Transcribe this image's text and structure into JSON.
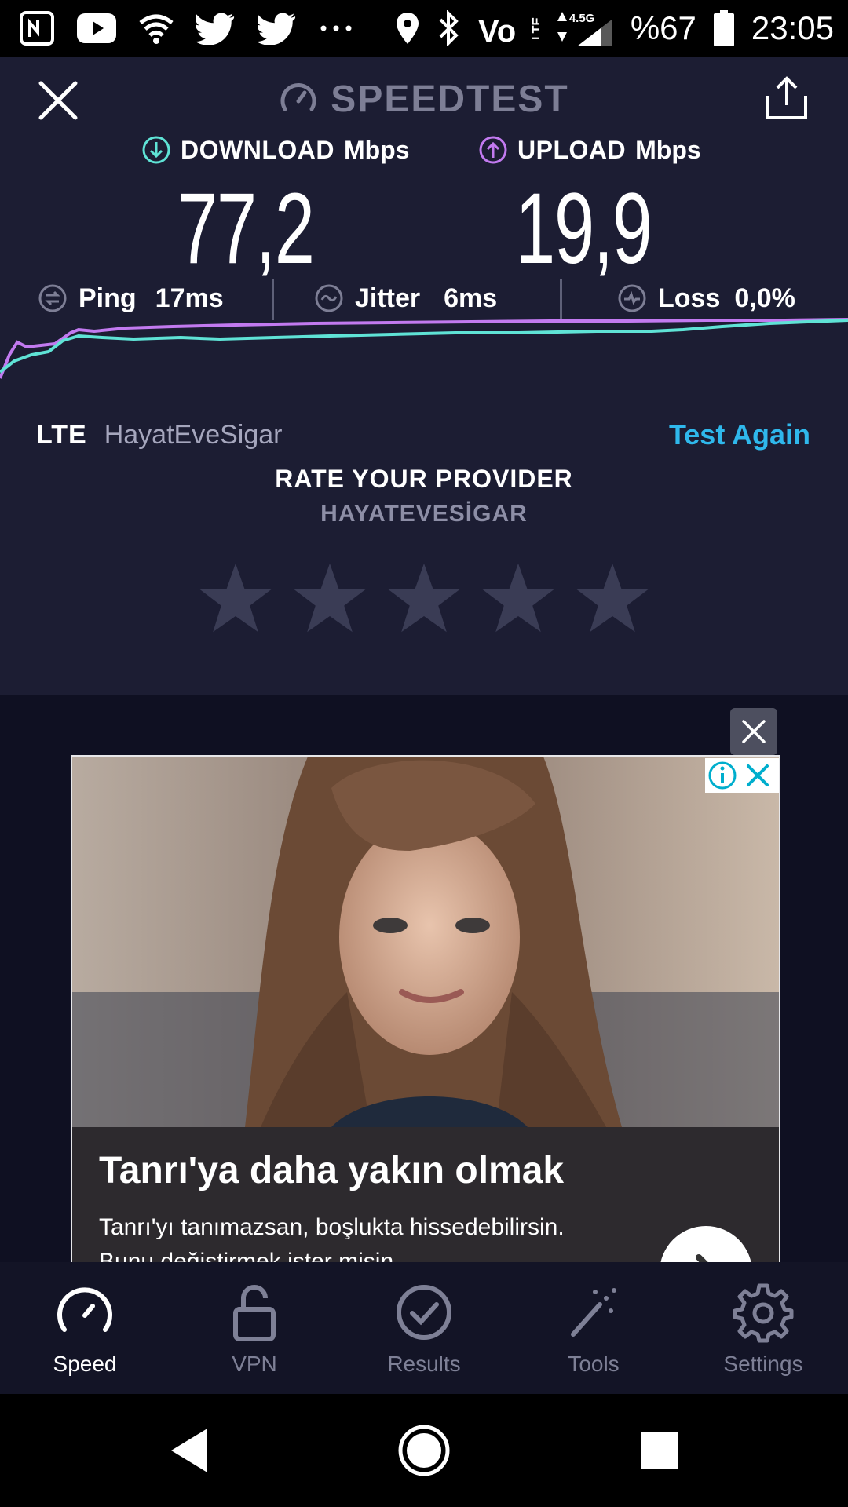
{
  "status_bar": {
    "icons": [
      "nfc-icon",
      "youtube-icon",
      "wifi-icon",
      "twitter-icon",
      "twitter-icon",
      "more-icon",
      "location-icon",
      "bluetooth-icon",
      "volte-icon",
      "signal-icon",
      "battery-icon"
    ],
    "network_type": "4.5G",
    "battery": "%67",
    "time": "23:05"
  },
  "header": {
    "title": "SPEEDTEST"
  },
  "download": {
    "label": "DOWNLOAD",
    "unit": "Mbps",
    "value": "77,2",
    "color": "#5fe3d6"
  },
  "upload": {
    "label": "UPLOAD",
    "unit": "Mbps",
    "value": "19,9",
    "color": "#c27af0"
  },
  "stats": {
    "ping": {
      "label": "Ping",
      "value": "17ms"
    },
    "jitter": {
      "label": "Jitter",
      "value": "6ms"
    },
    "loss": {
      "label": "Loss",
      "value": "0,0%"
    }
  },
  "network": {
    "type": "LTE",
    "provider": "HayatEveSigar",
    "test_again": "Test Again"
  },
  "rating": {
    "title": "RATE YOUR PROVIDER",
    "provider": "HAYATEVESİGAR",
    "stars": 5,
    "filled": 0
  },
  "ad": {
    "headline": "Tanrı'ya daha yakın olmak",
    "body_line1": "Tanrı'yı tanımazsan, boşlukta hissedebilirsin.",
    "body_line2": "Bunu değiştirmek ister misin..."
  },
  "bottom_nav": [
    {
      "label": "Speed",
      "icon": "speedometer-icon",
      "active": true
    },
    {
      "label": "VPN",
      "icon": "lock-icon",
      "active": false
    },
    {
      "label": "Results",
      "icon": "check-circle-icon",
      "active": false
    },
    {
      "label": "Tools",
      "icon": "magic-wand-icon",
      "active": false
    },
    {
      "label": "Settings",
      "icon": "gear-icon",
      "active": false
    }
  ],
  "colors": {
    "background": "#1c1d33",
    "accent": "#2fb8ec",
    "download": "#5fe3d6",
    "upload": "#c27af0"
  }
}
